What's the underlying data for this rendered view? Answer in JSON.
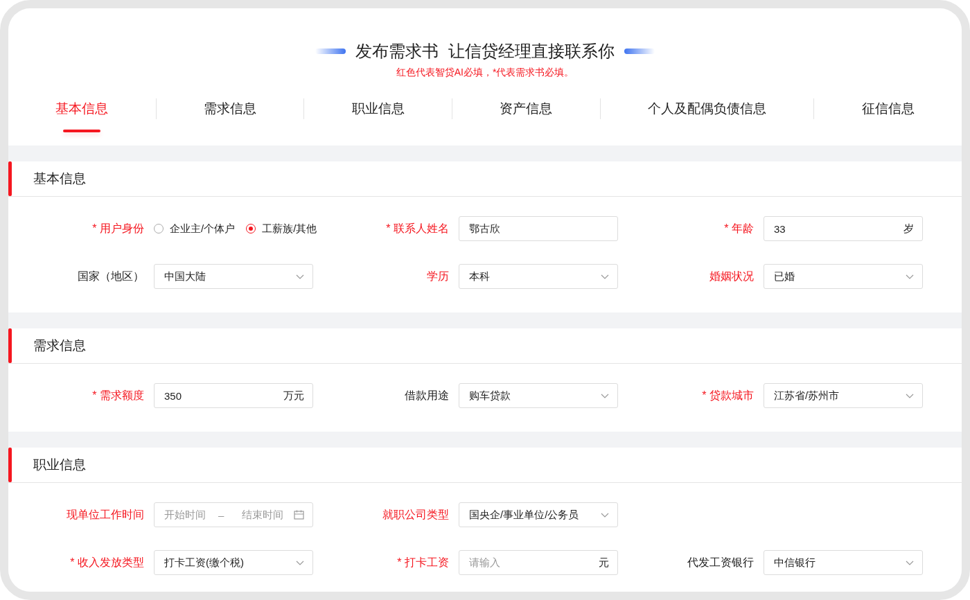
{
  "header": {
    "title": "发布需求书  让信贷经理直接联系你",
    "subtitle": "红色代表智贷AI必填，*代表需求书必填。"
  },
  "tabs": [
    {
      "label": "基本信息",
      "selected": true
    },
    {
      "label": "需求信息",
      "selected": false
    },
    {
      "label": "职业信息",
      "selected": false
    },
    {
      "label": "资产信息",
      "selected": false
    },
    {
      "label": "个人及配偶负债信息",
      "selected": false
    },
    {
      "label": "征信信息",
      "selected": false
    }
  ],
  "sections": [
    {
      "title": "基本信息",
      "rows": [
        [
          {
            "label": "* 用户身份",
            "label_red": true,
            "kind": "radio",
            "options": [
              {
                "label": "企业主/个体户",
                "selected": false
              },
              {
                "label": "工薪族/其他",
                "selected": true
              }
            ]
          },
          {
            "label": "* 联系人姓名",
            "label_red": true,
            "kind": "input",
            "value": "鄂古欣"
          },
          {
            "label": "* 年龄",
            "label_red": true,
            "kind": "input",
            "value": "33",
            "suffix": "岁"
          }
        ],
        [
          {
            "label": "国家（地区）",
            "label_red": false,
            "kind": "select",
            "value": "中国大陆"
          },
          {
            "label": "学历",
            "label_red": true,
            "kind": "select",
            "value": "本科"
          },
          {
            "label": "婚姻状况",
            "label_red": true,
            "kind": "select",
            "value": "已婚"
          }
        ]
      ]
    },
    {
      "title": "需求信息",
      "rows": [
        [
          {
            "label": "* 需求额度",
            "label_red": true,
            "kind": "input",
            "value": "350",
            "suffix": "万元"
          },
          {
            "label": "借款用途",
            "label_red": false,
            "kind": "select",
            "value": "购车贷款"
          },
          {
            "label": "* 贷款城市",
            "label_red": true,
            "kind": "select",
            "value": "江苏省/苏州市"
          }
        ]
      ]
    },
    {
      "title": "职业信息",
      "rows": [
        [
          {
            "label": "现单位工作时间",
            "label_red": true,
            "kind": "daterange",
            "start_placeholder": "开始时间",
            "separator": "–",
            "end_placeholder": "结束时间"
          },
          {
            "label": "就职公司类型",
            "label_red": true,
            "kind": "select",
            "value": "国央企/事业单位/公务员"
          }
        ],
        [
          {
            "label": "* 收入发放类型",
            "label_red": true,
            "kind": "select",
            "value": "打卡工资(缴个税)"
          },
          {
            "label": "* 打卡工资",
            "label_red": true,
            "kind": "input",
            "placeholder": "请输入",
            "suffix": "元"
          },
          {
            "label": "代发工资银行",
            "label_red": false,
            "kind": "select",
            "value": "中信银行"
          }
        ]
      ]
    }
  ]
}
